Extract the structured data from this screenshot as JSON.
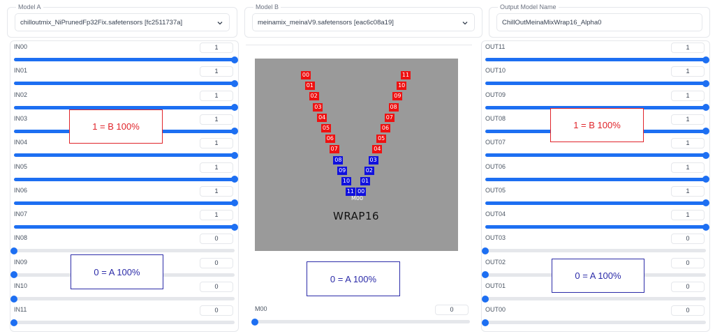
{
  "header": {
    "model_a": {
      "legend": "Model A",
      "value": "chilloutmix_NiPrunedFp32Fix.safetensors [fc2511737a]"
    },
    "model_b": {
      "legend": "Model B",
      "value": "meinamix_meinaV9.safetensors [eac6c08a19]"
    },
    "output": {
      "legend": "Output Model Name",
      "value": "ChillOutMeinaMixWrap16_Alpha0"
    }
  },
  "left_sliders": [
    {
      "label": "IN00",
      "value": "1",
      "level": 1
    },
    {
      "label": "IN01",
      "value": "1",
      "level": 1
    },
    {
      "label": "IN02",
      "value": "1",
      "level": 1
    },
    {
      "label": "IN03",
      "value": "1",
      "level": 1
    },
    {
      "label": "IN04",
      "value": "1",
      "level": 1
    },
    {
      "label": "IN05",
      "value": "1",
      "level": 1
    },
    {
      "label": "IN06",
      "value": "1",
      "level": 1
    },
    {
      "label": "IN07",
      "value": "1",
      "level": 1
    },
    {
      "label": "IN08",
      "value": "0",
      "level": 0
    },
    {
      "label": "IN09",
      "value": "0",
      "level": 0
    },
    {
      "label": "IN10",
      "value": "0",
      "level": 0
    },
    {
      "label": "IN11",
      "value": "0",
      "level": 0
    }
  ],
  "right_sliders": [
    {
      "label": "OUT11",
      "value": "1",
      "level": 1
    },
    {
      "label": "OUT10",
      "value": "1",
      "level": 1
    },
    {
      "label": "OUT09",
      "value": "1",
      "level": 1
    },
    {
      "label": "OUT08",
      "value": "1",
      "level": 1
    },
    {
      "label": "OUT07",
      "value": "1",
      "level": 1
    },
    {
      "label": "OUT06",
      "value": "1",
      "level": 1
    },
    {
      "label": "OUT05",
      "value": "1",
      "level": 1
    },
    {
      "label": "OUT04",
      "value": "1",
      "level": 1
    },
    {
      "label": "OUT03",
      "value": "0",
      "level": 0
    },
    {
      "label": "OUT02",
      "value": "0",
      "level": 0
    },
    {
      "label": "OUT01",
      "value": "0",
      "level": 0
    },
    {
      "label": "OUT00",
      "value": "0",
      "level": 0
    }
  ],
  "middle_slider": {
    "label": "M00",
    "value": "0",
    "level": 0
  },
  "graphic": {
    "title": "WRAP16",
    "left_arm": [
      {
        "text": "00",
        "color": "red"
      },
      {
        "text": "01",
        "color": "red"
      },
      {
        "text": "02",
        "color": "red"
      },
      {
        "text": "03",
        "color": "red"
      },
      {
        "text": "04",
        "color": "red"
      },
      {
        "text": "05",
        "color": "red"
      },
      {
        "text": "06",
        "color": "red"
      },
      {
        "text": "07",
        "color": "red"
      },
      {
        "text": "08",
        "color": "blue"
      },
      {
        "text": "09",
        "color": "blue"
      },
      {
        "text": "10",
        "color": "blue"
      },
      {
        "text": "11",
        "color": "blue"
      }
    ],
    "right_arm": [
      {
        "text": "11",
        "color": "red"
      },
      {
        "text": "10",
        "color": "red"
      },
      {
        "text": "09",
        "color": "red"
      },
      {
        "text": "08",
        "color": "red"
      },
      {
        "text": "07",
        "color": "red"
      },
      {
        "text": "06",
        "color": "red"
      },
      {
        "text": "05",
        "color": "red"
      },
      {
        "text": "04",
        "color": "red"
      },
      {
        "text": "03",
        "color": "blue"
      },
      {
        "text": "02",
        "color": "blue"
      },
      {
        "text": "01",
        "color": "blue"
      },
      {
        "text": "00",
        "color": "blue"
      }
    ],
    "middle_label": "M00"
  },
  "notes": {
    "left_b": "1 = B 100%",
    "left_a": "0 = A 100%",
    "center_a": "0 = A 100%",
    "right_b": "1 = B 100%",
    "right_a": "0 = A 100%"
  },
  "colors": {
    "accent": "#1d6ff2",
    "block_a": "#ee1111",
    "block_b": "#1010dd",
    "note_red": "#e0242a",
    "note_blue": "#2b2ba8"
  }
}
